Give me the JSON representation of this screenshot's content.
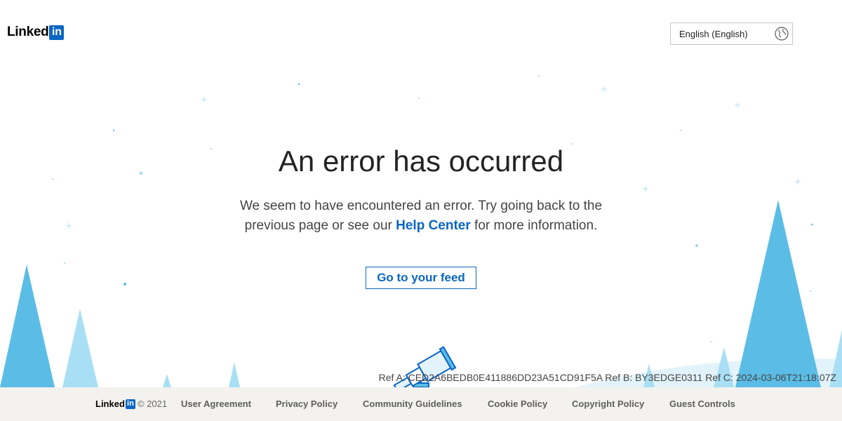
{
  "header": {
    "logo_text": "Linked",
    "logo_mark": "in",
    "language_label": "English (English)",
    "language_icon": "globe-icon"
  },
  "main": {
    "title": "An error has occurred",
    "message_before": "We seem to have encountered an error. Try going back to the previous page or see our ",
    "help_link": "Help Center",
    "message_after": " for more information.",
    "feed_button": "Go to your feed",
    "refs": "Ref A: CED2A6BEDB0E411886DD23A51CD91F5A Ref B: BY3EDGE0311 Ref C: 2024-03-06T21:18:07Z"
  },
  "footer": {
    "logo_text": "Linked",
    "logo_mark": "in",
    "copyright": "© 2021",
    "links": [
      "User Agreement",
      "Privacy Policy",
      "Community Guidelines",
      "Cookie Policy",
      "Copyright Policy",
      "Guest Controls"
    ]
  },
  "colors": {
    "brand": "#0a66c2",
    "tree_dark": "#5bbde6",
    "tree_light": "#a9dff4",
    "footer_bg": "#f3f2ef"
  }
}
